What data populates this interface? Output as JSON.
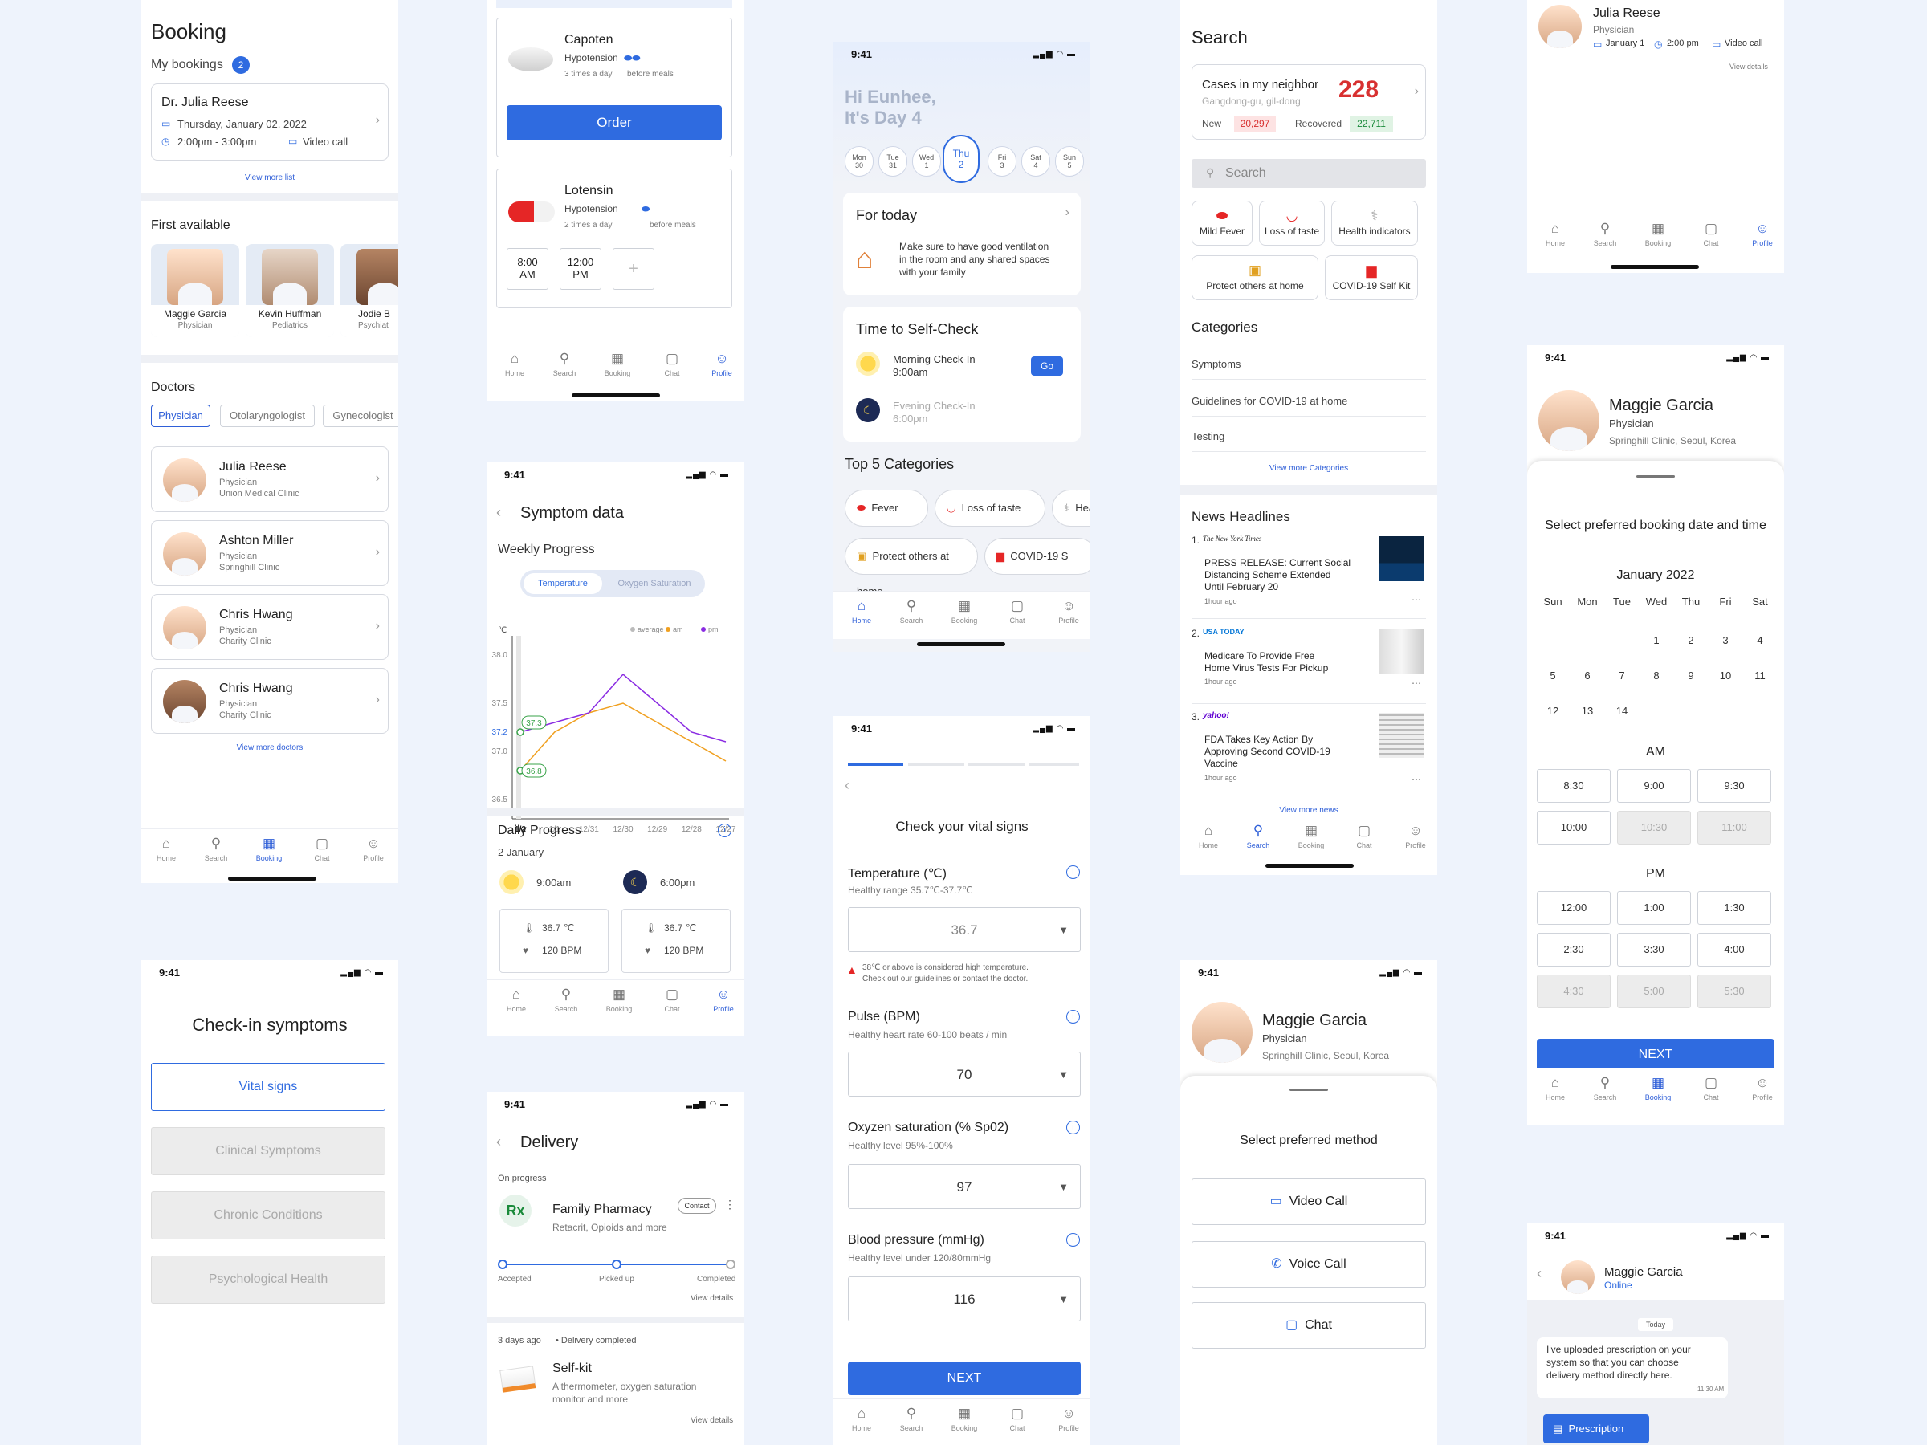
{
  "nav": {
    "home": "Home",
    "search": "Search",
    "booking": "Booking",
    "chat": "Chat",
    "profile": "Profile"
  },
  "status_time": "9:41",
  "booking": {
    "title": "Booking",
    "my_bookings": "My bookings",
    "count": "2",
    "appt": {
      "doctor": "Dr. Julia Reese",
      "date": "Thursday, January 02, 2022",
      "time": "2:00pm - 3:00pm",
      "type": "Video call"
    },
    "view_more_list": "View more list",
    "first_available": "First available",
    "available": [
      {
        "name": "Maggie Garcia",
        "role": "Physician"
      },
      {
        "name": "Kevin Huffman",
        "role": "Pediatrics"
      },
      {
        "name": "Jodie B",
        "role": "Psychiat"
      }
    ],
    "doctors_title": "Doctors",
    "filters": [
      "Physician",
      "Otolaryngologist",
      "Gynecologist"
    ],
    "doctors": [
      {
        "name": "Julia Reese",
        "role": "Physician",
        "clinic": "Union Medical Clinic"
      },
      {
        "name": "Ashton Miller",
        "role": "Physician",
        "clinic": "Springhill Clinic"
      },
      {
        "name": "Chris Hwang",
        "role": "Physician",
        "clinic": "Charity Clinic"
      },
      {
        "name": "Chris Hwang",
        "role": "Physician",
        "clinic": "Charity Clinic"
      }
    ],
    "view_more_doctors": "View more doctors"
  },
  "checkin": {
    "title": "Check-in symptoms",
    "options": [
      "Vital signs",
      "Clinical Symptoms",
      "Chronic Conditions",
      "Psychological Health"
    ]
  },
  "meds": {
    "m1": {
      "name": "Capoten",
      "cond": "Hypotension",
      "freq": "3 times a day",
      "when": "before meals"
    },
    "order": "Order",
    "m2": {
      "name": "Lotensin",
      "cond": "Hypotension",
      "freq": "2 times a day",
      "when": "before meals"
    },
    "times": [
      "8:00",
      "AM",
      "12:00",
      "PM"
    ],
    "add": "+"
  },
  "symptom": {
    "title": "Symptom data",
    "weekly": "Weekly Progress",
    "tab1": "Temperature",
    "tab2": "Oxygen Saturation",
    "unit": "℃",
    "legend": [
      "average",
      "am",
      "pm"
    ],
    "yticks": [
      "38.0",
      "37.5",
      "37.2",
      "37.0",
      "36.5"
    ],
    "xticks": [
      "1/2",
      "1/1",
      "12/31",
      "12/30",
      "12/29",
      "12/28",
      "12/27"
    ],
    "badges": [
      "37.3",
      "36.8"
    ],
    "daily": "Daily Progress",
    "date": "2 January",
    "am": {
      "time": "9:00am",
      "temp": "36.7 ℃",
      "bpm": "120 BPM"
    },
    "pm": {
      "time": "6:00pm",
      "temp": "36.7 ℃",
      "bpm": "120 BPM"
    }
  },
  "chart_data": {
    "type": "line",
    "x": [
      "12/27",
      "12/28",
      "12/29",
      "12/30",
      "12/31",
      "1/1",
      "1/2"
    ],
    "series": [
      {
        "name": "am",
        "values": [
          36.9,
          37.1,
          37.3,
          37.5,
          37.4,
          37.2,
          36.8
        ]
      },
      {
        "name": "pm",
        "values": [
          37.1,
          37.2,
          37.5,
          37.8,
          37.4,
          37.3,
          37.2
        ]
      }
    ],
    "ylabel": "℃",
    "ylim": [
      36.3,
      38.2
    ]
  },
  "delivery": {
    "title": "Delivery",
    "on_progress": "On progress",
    "pharmacy": "Family Pharmacy",
    "items": "Retacrit, Opioids and more",
    "contact": "Contact",
    "steps": [
      "Accepted",
      "Picked up",
      "Completed"
    ],
    "view": "View details",
    "past_when": "3 days ago",
    "past_status": "Delivery completed",
    "kit": "Self-kit",
    "kit_desc1": "A thermometer, oxygen saturation",
    "kit_desc2": "monitor and more",
    "view2": "View details"
  },
  "home": {
    "greet1": "Hi Eunhee,",
    "greet2": "It's Day 4",
    "days": [
      {
        "d": "Mon",
        "n": "30"
      },
      {
        "d": "Tue",
        "n": "31"
      },
      {
        "d": "Wed",
        "n": "1"
      },
      {
        "d": "Thu",
        "n": "2"
      },
      {
        "d": "Fri",
        "n": "3"
      },
      {
        "d": "Sat",
        "n": "4"
      },
      {
        "d": "Sun",
        "n": "5"
      }
    ],
    "today": "For today",
    "today_text": [
      "Make sure to have good ventilation",
      "in the room and any shared spaces",
      "with your family"
    ],
    "selfcheck": "Time to Self-Check",
    "morning": "Morning Check-In",
    "morning_t": "9:00am",
    "go": "Go",
    "evening": "Evening Check-In",
    "evening_t": "6:00pm",
    "top5": "Top 5 Categories",
    "cats": [
      "Fever",
      "Loss of taste",
      "Hea",
      "Protect others at home",
      "COVID-19 S"
    ]
  },
  "vitals": {
    "title": "Check your vital signs",
    "temp": {
      "label": "Temperature (℃)",
      "hint": "Healthy range 35.7℃-37.7℃",
      "value": "36.7",
      "warn1": "38℃ or above is considered high temperature.",
      "warn2": "Check out our guidelines or contact the doctor."
    },
    "pulse": {
      "label": "Pulse (BPM)",
      "hint": "Healthy heart rate 60-100 beats / min",
      "value": "70"
    },
    "oxy": {
      "label": "Oxyzen saturation (% Sp02)",
      "hint": "Healthy level 95%-100%",
      "value": "97"
    },
    "bp": {
      "label": "Blood pressure (mmHg)",
      "hint": "Healthy level under 120/80mmHg",
      "value": "116"
    },
    "next": "NEXT",
    "progress": 0.25
  },
  "search": {
    "title": "Search",
    "cases": "Cases in my neighbor",
    "loc": "Gangdong-gu, gil-dong",
    "total": "228",
    "new_l": "New",
    "new_v": "20,297",
    "rec_l": "Recovered",
    "rec_v": "22,711",
    "placeholder": "Search",
    "syms": [
      "Mild Fever",
      "Loss of taste",
      "Health indicators",
      "Protect others at home",
      "COVID-19 Self Kit"
    ],
    "categories": "Categories",
    "cat_items": [
      "Symptoms",
      "Guidelines for COVID-19 at home",
      "Testing"
    ],
    "view_cats": "View more Categories",
    "news": "News Headlines",
    "headlines": [
      {
        "n": "1.",
        "src": "The New York Times",
        "t": [
          "PRESS RELEASE: Current Social",
          "Distancing Scheme Extended",
          "Until February 20"
        ],
        "ago": "1hour ago"
      },
      {
        "n": "2.",
        "src": "USA TODAY",
        "t": [
          "Medicare To Provide Free",
          "Home Virus Tests For Pickup"
        ],
        "ago": "1hour ago"
      },
      {
        "n": "3.",
        "src": "yahoo!",
        "t": [
          "FDA Takes Key Action By",
          "Approving Second COVID-19",
          "Vaccine"
        ],
        "ago": "1hour ago"
      }
    ],
    "view_news": "View more news"
  },
  "method": {
    "name": "Maggie Garcia",
    "role": "Physician",
    "clinic": "Springhill Clinic, Seoul, Korea",
    "title": "Select preferred method",
    "opts": [
      "Video Call",
      "Voice Call",
      "Chat"
    ]
  },
  "profile": {
    "name": "Julia Reese",
    "role": "Physician",
    "date": "January 1",
    "time": "2:00 pm",
    "type": "Video call",
    "view": "View details"
  },
  "slot": {
    "name": "Maggie Garcia",
    "role": "Physician",
    "clinic": "Springhill Clinic, Seoul, Korea",
    "title": "Select preferred booking date and time",
    "month": "January 2022",
    "dow": [
      "Sun",
      "Mon",
      "Tue",
      "Wed",
      "Thu",
      "Fri",
      "Sat"
    ],
    "am": "AM",
    "pm": "PM",
    "am_slots": [
      "8:30",
      "9:00",
      "9:30",
      "10:00",
      "10:30",
      "11:00"
    ],
    "pm_slots": [
      "12:00",
      "1:00",
      "1:30",
      "2:30",
      "3:30",
      "4:00",
      "4:30",
      "5:00",
      "5:30"
    ],
    "next": "NEXT"
  },
  "chat": {
    "name": "Maggie Garcia",
    "online": "Online",
    "today": "Today",
    "msg": [
      "I've uploaded prescription on your",
      "system so that you can choose",
      "delivery method directly here."
    ],
    "msg_time": "11:30 AM",
    "presc": "Prescription"
  }
}
